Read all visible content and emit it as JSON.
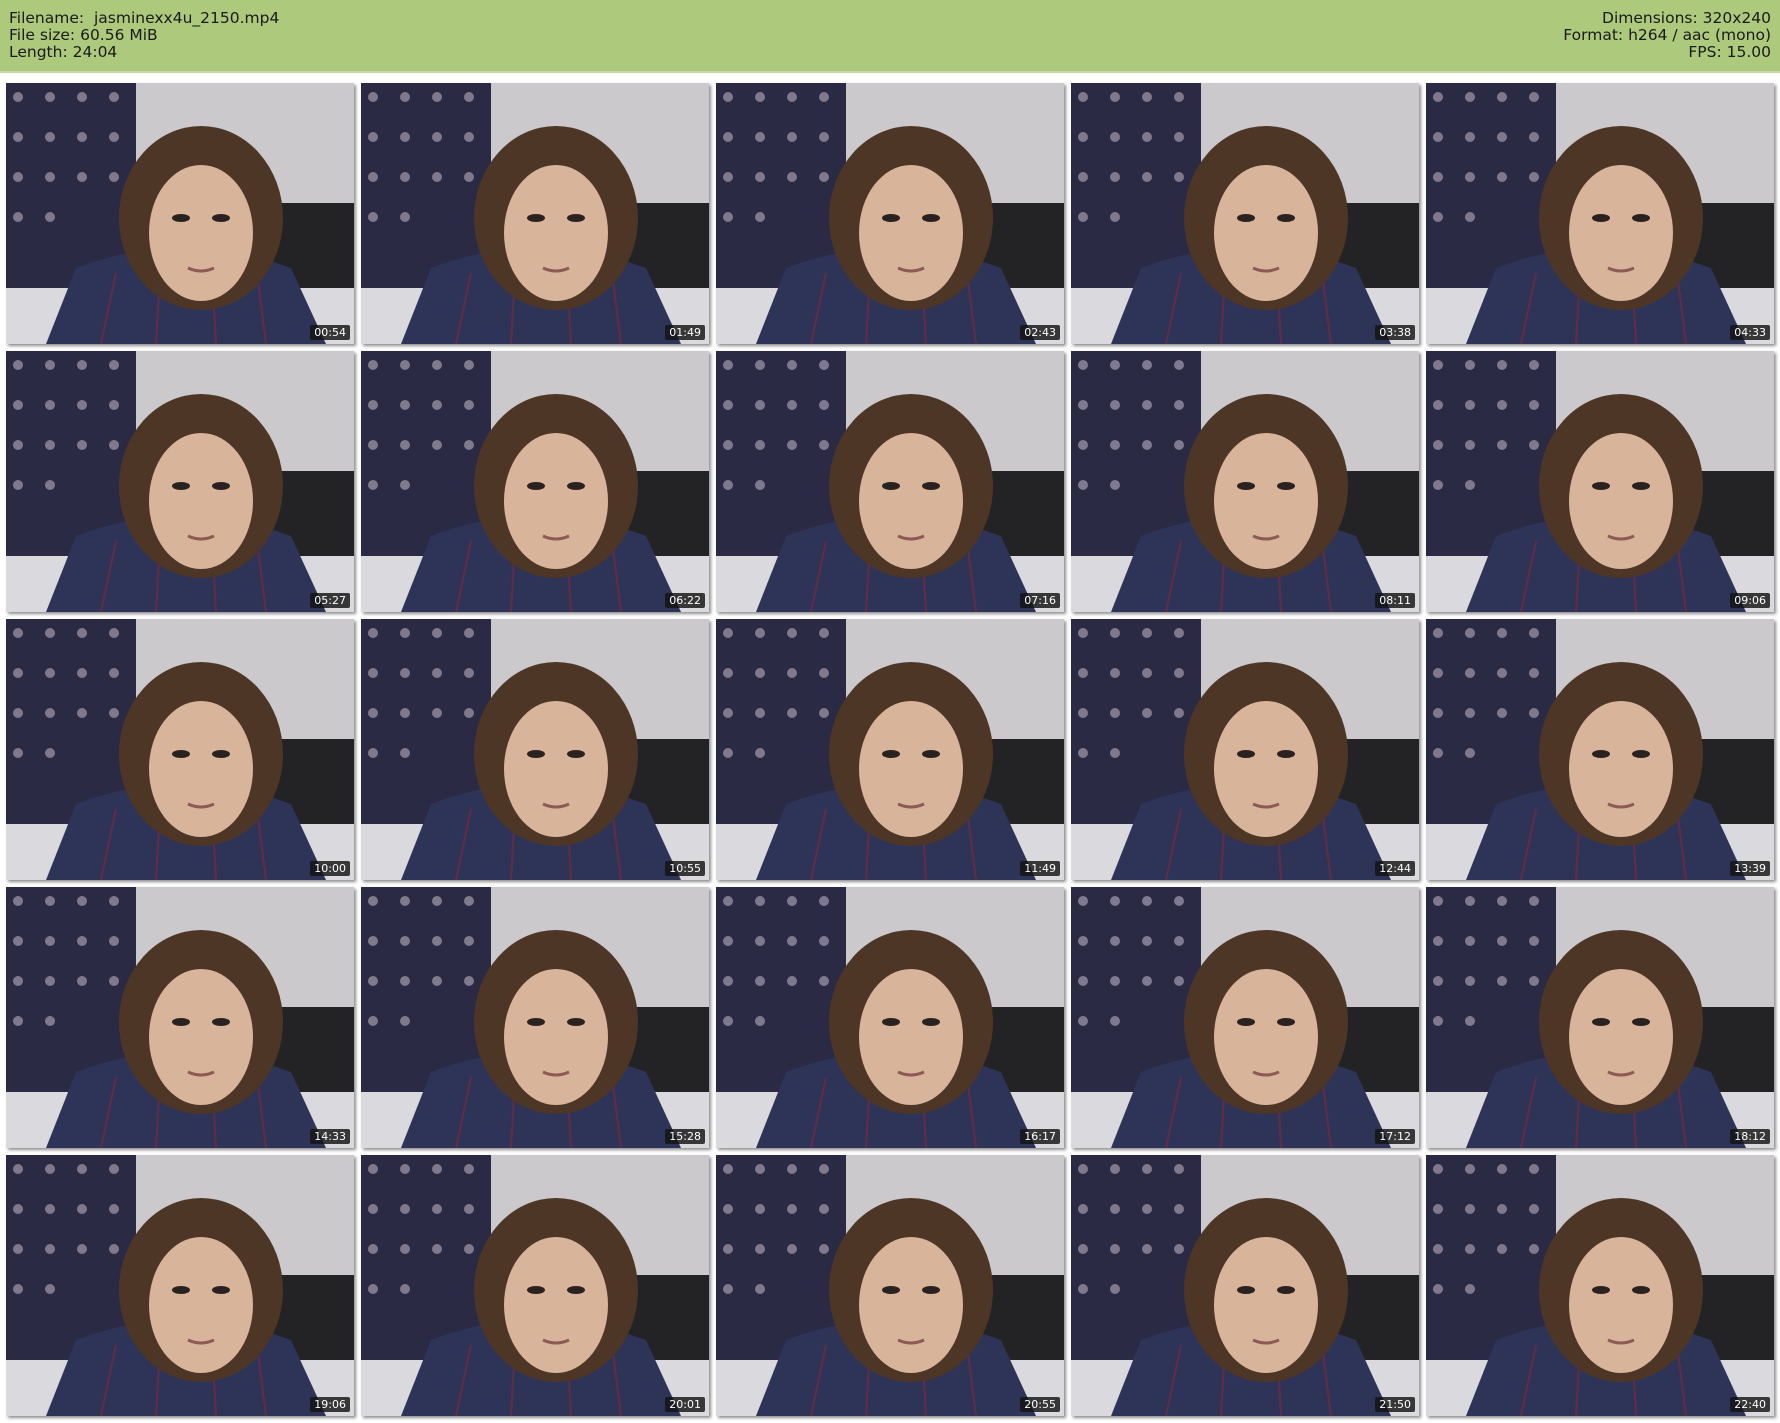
{
  "header": {
    "left": [
      {
        "label": "Filename:",
        "value": "jasminexx4u_2150.mp4"
      },
      {
        "label": "File size:",
        "value": "60.56 MiB"
      },
      {
        "label": "Length:",
        "value": "24:04"
      }
    ],
    "right": [
      {
        "label": "Dimensions:",
        "value": "320x240"
      },
      {
        "label": "Format:",
        "value": "h264 / aac (mono)"
      },
      {
        "label": "FPS:",
        "value": "15.00"
      }
    ],
    "background_color": "#adc97c"
  },
  "thumbnails": [
    {
      "timestamp": "00:54"
    },
    {
      "timestamp": "01:49"
    },
    {
      "timestamp": "02:43"
    },
    {
      "timestamp": "03:38"
    },
    {
      "timestamp": "04:33"
    },
    {
      "timestamp": "05:27"
    },
    {
      "timestamp": "06:22"
    },
    {
      "timestamp": "07:16"
    },
    {
      "timestamp": "08:11"
    },
    {
      "timestamp": "09:06"
    },
    {
      "timestamp": "10:00"
    },
    {
      "timestamp": "10:55"
    },
    {
      "timestamp": "11:49"
    },
    {
      "timestamp": "12:44"
    },
    {
      "timestamp": "13:39"
    },
    {
      "timestamp": "14:33"
    },
    {
      "timestamp": "15:28"
    },
    {
      "timestamp": "16:17"
    },
    {
      "timestamp": "17:12"
    },
    {
      "timestamp": "18:12"
    },
    {
      "timestamp": "19:06"
    },
    {
      "timestamp": "20:01"
    },
    {
      "timestamp": "20:55"
    },
    {
      "timestamp": "21:50"
    },
    {
      "timestamp": "22:40"
    }
  ]
}
